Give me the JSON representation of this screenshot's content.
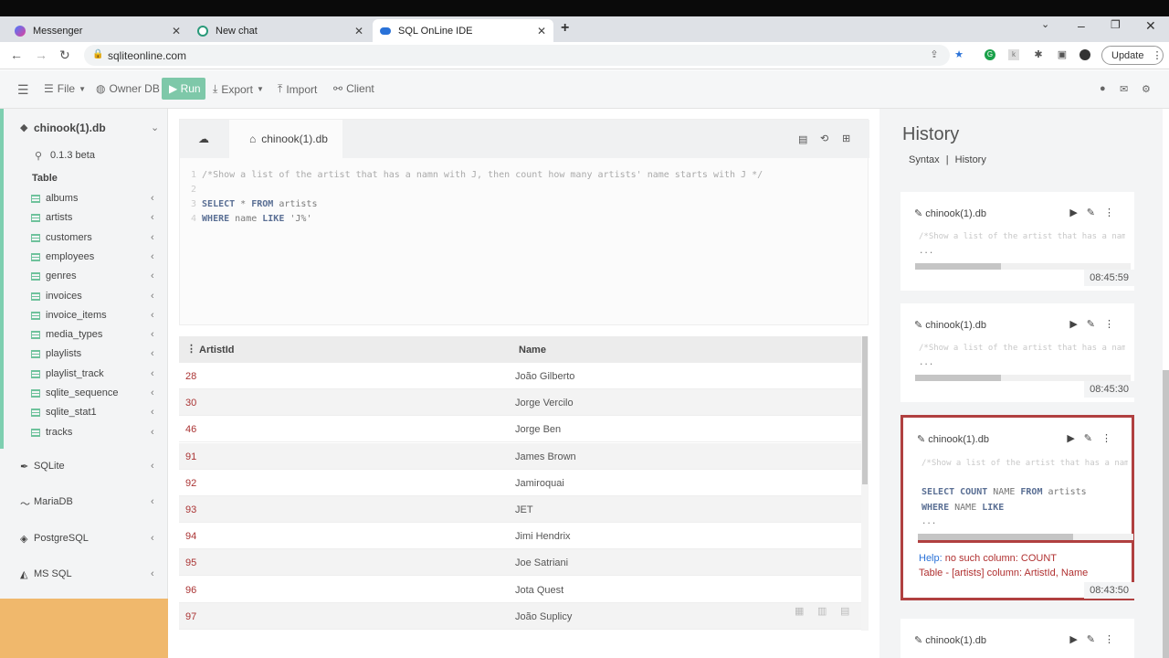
{
  "browser": {
    "tabs": [
      {
        "title": "Messenger"
      },
      {
        "title": "New chat"
      },
      {
        "title": "SQL OnLine IDE"
      }
    ],
    "url": "sqliteonline.com",
    "update_label": "Update"
  },
  "toolbar": {
    "file": "File",
    "owner_db": "Owner DB",
    "run": "Run",
    "export": "Export",
    "import": "Import",
    "client": "Client"
  },
  "sidebar": {
    "db_name": "chinook(1).db",
    "version": "0.1.3 beta",
    "section": "Table",
    "tables": [
      "albums",
      "artists",
      "customers",
      "employees",
      "genres",
      "invoices",
      "invoice_items",
      "media_types",
      "playlists",
      "playlist_track",
      "sqlite_sequence",
      "sqlite_stat1",
      "tracks"
    ],
    "engines": [
      "SQLite",
      "MariaDB",
      "PostgreSQL",
      "MS SQL"
    ]
  },
  "editor": {
    "tab": "chinook(1).db",
    "lines": [
      {
        "n": "1",
        "comment": "/*Show a list of the artist that has a namn with J, then count how many artists' name starts with J */"
      },
      {
        "n": "2"
      },
      {
        "n": "3",
        "k1": "SELECT",
        "mid": " * ",
        "k2": "FROM",
        "rest": " artists"
      },
      {
        "n": "4",
        "k1": "WHERE",
        "mid": " name ",
        "k2": "LIKE",
        "rest": " 'J%'"
      }
    ]
  },
  "results": {
    "columns": [
      "ArtistId",
      "Name"
    ],
    "rows": [
      [
        "28",
        "João Gilberto"
      ],
      [
        "30",
        "Jorge Vercilo"
      ],
      [
        "46",
        "Jorge Ben"
      ],
      [
        "91",
        "James Brown"
      ],
      [
        "92",
        "Jamiroquai"
      ],
      [
        "93",
        "JET"
      ],
      [
        "94",
        "Jimi Hendrix"
      ],
      [
        "95",
        "Joe Satriani"
      ],
      [
        "96",
        "Jota Quest"
      ],
      [
        "97",
        "João Suplicy"
      ]
    ]
  },
  "history": {
    "title": "History",
    "links": [
      "Syntax",
      "|",
      "History"
    ],
    "cards": [
      {
        "db": "chinook(1).db",
        "comment": "/*Show a list of the artist that has a namn with J, then count",
        "dots": "...",
        "time": "08:45:59",
        "progress": 0.4
      },
      {
        "db": "chinook(1).db",
        "comment": "/*Show a list of the artist that has a namn with J, then count",
        "dots": "...",
        "time": "08:45:30",
        "progress": 0.4
      },
      {
        "db": "chinook(1).db",
        "comment": "/*Show a list of the artist that has a namn with J, then count",
        "q1a": "SELECT",
        "q1b": " COUNT ",
        "q1c": "NAME ",
        "q1d": "FROM",
        "q1e": " artists",
        "q2a": "WHERE",
        "q2b": " NAME ",
        "q2c": "LIKE",
        "dots": "...",
        "time": "08:43:50",
        "progress": 0.72,
        "help_label": "Help:",
        "help_text": " no such column: COUNT",
        "table_info": "Table - [artists] column: ArtistId, Name"
      },
      {
        "db": "chinook(1).db"
      }
    ]
  }
}
